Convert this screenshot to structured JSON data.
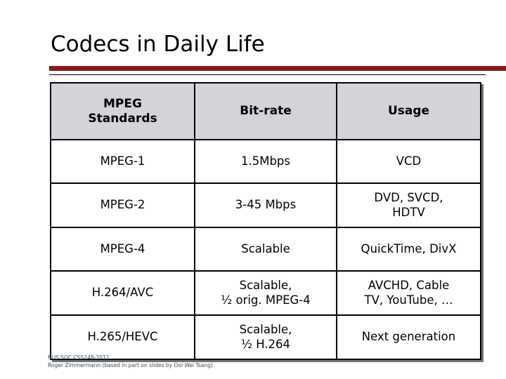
{
  "slide": {
    "title": "Codecs in Daily Life",
    "accent_color": "#8c1a1a",
    "header_fill": "#d2d4da",
    "border_color": "#000000",
    "background": "#ffffff"
  },
  "table": {
    "headers": {
      "col1_line1": "MPEG",
      "col1_line2": "Standards",
      "col2": "Bit-rate",
      "col3": "Usage"
    },
    "rows": [
      {
        "standard": "MPEG-1",
        "bitrate_line1": "1.5Mbps",
        "bitrate_line2": "",
        "usage_line1": "VCD",
        "usage_line2": ""
      },
      {
        "standard": "MPEG-2",
        "bitrate_line1": "3-45 Mbps",
        "bitrate_line2": "",
        "usage_line1": "DVD, SVCD,",
        "usage_line2": "HDTV"
      },
      {
        "standard": "MPEG-4",
        "bitrate_line1": "Scalable",
        "bitrate_line2": "",
        "usage_line1": "QuickTime, DivX",
        "usage_line2": ""
      },
      {
        "standard": "H.264/AVC",
        "bitrate_line1": "Scalable,",
        "bitrate_line2": "½ orig. MPEG-4",
        "usage_line1": "AVCHD, Cable",
        "usage_line2": "TV, YouTube, …"
      },
      {
        "standard": "H.265/HEVC",
        "bitrate_line1": "Scalable,",
        "bitrate_line2": "½ H.264",
        "usage_line1": "Next generation",
        "usage_line2": ""
      }
    ]
  },
  "footer": {
    "line1": "NUS.SOC.CS5248-2012",
    "line2": "Roger Zimmermann (based in part on slides by Ooi Wei Tsang)"
  }
}
